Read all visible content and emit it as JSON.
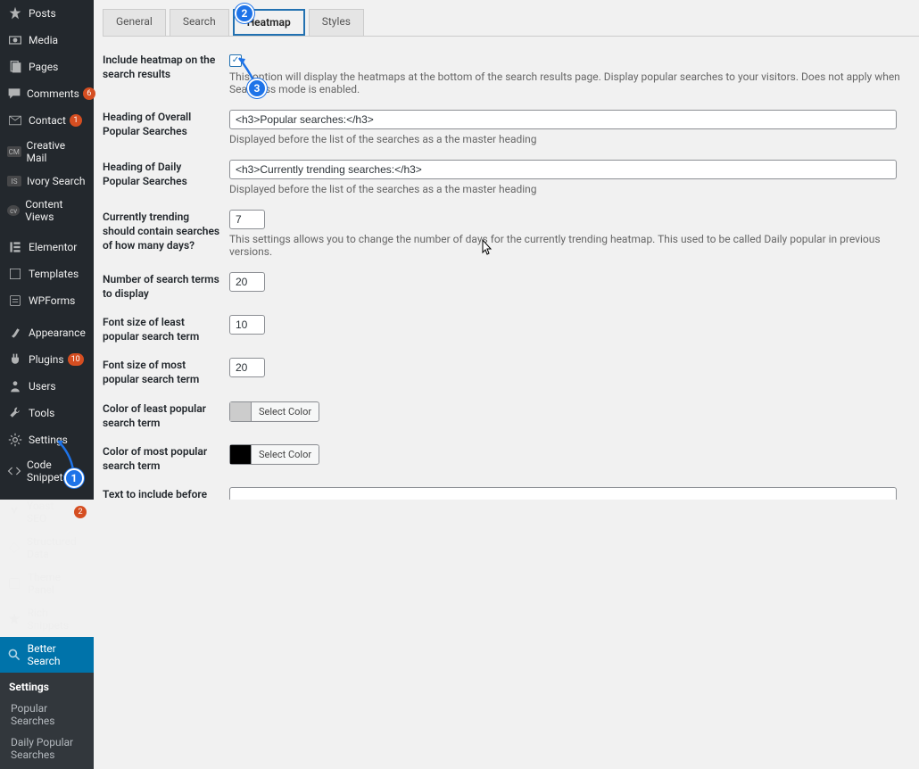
{
  "sidebar": {
    "items": [
      {
        "label": "Posts",
        "icon": "pin"
      },
      {
        "label": "Media",
        "icon": "media"
      },
      {
        "label": "Pages",
        "icon": "page"
      },
      {
        "label": "Comments",
        "icon": "comment",
        "badge": "6"
      },
      {
        "label": "Contact",
        "icon": "mail",
        "badge": "1"
      },
      {
        "label": "Creative Mail",
        "icon": "cm"
      },
      {
        "label": "Ivory Search",
        "icon": "is"
      },
      {
        "label": "Content Views",
        "icon": "cv"
      },
      {
        "label": "Elementor",
        "icon": "elementor"
      },
      {
        "label": "Templates",
        "icon": "templates"
      },
      {
        "label": "WPForms",
        "icon": "wpforms"
      },
      {
        "label": "Appearance",
        "icon": "brush"
      },
      {
        "label": "Plugins",
        "icon": "plug",
        "badge": "10"
      },
      {
        "label": "Users",
        "icon": "user"
      },
      {
        "label": "Tools",
        "icon": "wrench"
      },
      {
        "label": "Settings",
        "icon": "gear"
      },
      {
        "label": "Code Snippets",
        "icon": "code"
      },
      {
        "label": "Yoast SEO",
        "icon": "yoast",
        "badge": "2"
      },
      {
        "label": "Structured Data",
        "icon": "struct"
      },
      {
        "label": "Theme Panel",
        "icon": "theme"
      },
      {
        "label": "Rich Snippets",
        "icon": "star"
      },
      {
        "label": "Better Search",
        "icon": "search",
        "active": true
      }
    ],
    "submenu": {
      "title": "Settings",
      "items": [
        "Popular Searches",
        "Daily Popular Searches"
      ]
    }
  },
  "tabs": [
    "General",
    "Search",
    "Heatmap",
    "Styles"
  ],
  "active_tab": "Heatmap",
  "fields": {
    "include_heatmap": {
      "label": "Include heatmap on the search results",
      "checked": true,
      "help": "This option will display the heatmaps at the bottom of the search results page. Display popular searches to your visitors. Does not apply when Seamless mode is enabled."
    },
    "heading_overall": {
      "label": "Heading of Overall Popular Searches",
      "value": "<h3>Popular searches:</h3>",
      "help": "Displayed before the list of the searches as a the master heading"
    },
    "heading_daily": {
      "label": "Heading of Daily Popular Searches",
      "value": "<h3>Currently trending searches:</h3>",
      "help": "Displayed before the list of the searches as a the master heading"
    },
    "trending_days": {
      "label": "Currently trending should contain searches of how many days?",
      "value": "7",
      "help": "This settings allows you to change the number of days for the currently trending heatmap. This used to be called Daily popular in previous versions."
    },
    "num_terms": {
      "label": "Number of search terms to display",
      "value": "20"
    },
    "font_least": {
      "label": "Font size of least popular search term",
      "value": "10"
    },
    "font_most": {
      "label": "Font size of most popular search term",
      "value": "20"
    },
    "color_least": {
      "label": "Color of least popular search term",
      "select": "Select Color",
      "swatch": "#cccccc"
    },
    "color_most": {
      "label": "Color of most popular search term",
      "select": "Select Color",
      "swatch": "#000000"
    },
    "text_before": {
      "label": "Text to include before each search term",
      "value": ""
    }
  },
  "annotations": {
    "1": "1",
    "2": "2",
    "3": "3"
  }
}
